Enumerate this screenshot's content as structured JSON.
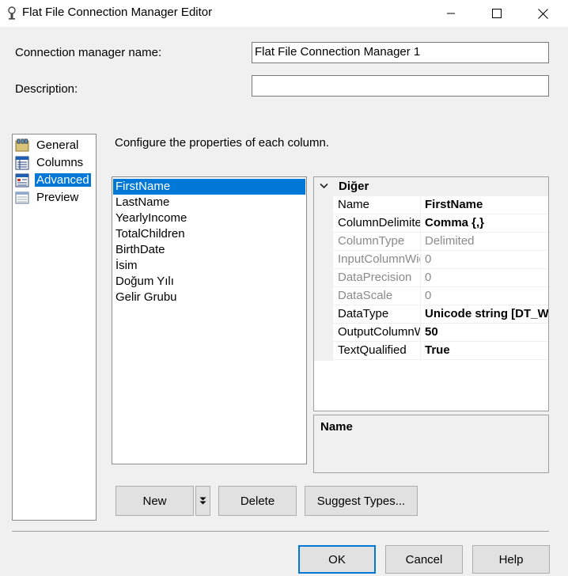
{
  "window": {
    "title": "Flat File Connection Manager Editor"
  },
  "form": {
    "name_label": "Connection manager name:",
    "name_value": "Flat File Connection Manager 1",
    "description_label": "Description:",
    "description_value": ""
  },
  "nav": {
    "items": [
      {
        "label": "General",
        "icon": "general-icon"
      },
      {
        "label": "Columns",
        "icon": "columns-icon"
      },
      {
        "label": "Advanced",
        "icon": "advanced-icon",
        "selected": true
      },
      {
        "label": "Preview",
        "icon": "preview-icon"
      }
    ]
  },
  "main": {
    "instruction": "Configure the properties of each column."
  },
  "columns": {
    "items": [
      "FirstName",
      "LastName",
      "YearlyIncome",
      "TotalChildren",
      "BirthDate",
      "İsim",
      "Doğum Yılı",
      "Gelir Grubu"
    ],
    "selected": "FirstName"
  },
  "properties": {
    "category": "Diğer",
    "rows": [
      {
        "name": "Name",
        "value": "FirstName",
        "enabled": true
      },
      {
        "name": "ColumnDelimiter",
        "value": "Comma {,}",
        "enabled": true
      },
      {
        "name": "ColumnType",
        "value": "Delimited",
        "enabled": false
      },
      {
        "name": "InputColumnWidth",
        "value": "0",
        "enabled": false
      },
      {
        "name": "DataPrecision",
        "value": "0",
        "enabled": false
      },
      {
        "name": "DataScale",
        "value": "0",
        "enabled": false
      },
      {
        "name": "DataType",
        "value": "Unicode string [DT_WSTR]",
        "enabled": true
      },
      {
        "name": "OutputColumnWidth",
        "value": "50",
        "enabled": true
      },
      {
        "name": "TextQualified",
        "value": "True",
        "enabled": true
      }
    ],
    "description_title": "Name"
  },
  "buttons": {
    "new": "New",
    "delete": "Delete",
    "suggest": "Suggest Types...",
    "ok": "OK",
    "cancel": "Cancel",
    "help": "Help"
  }
}
